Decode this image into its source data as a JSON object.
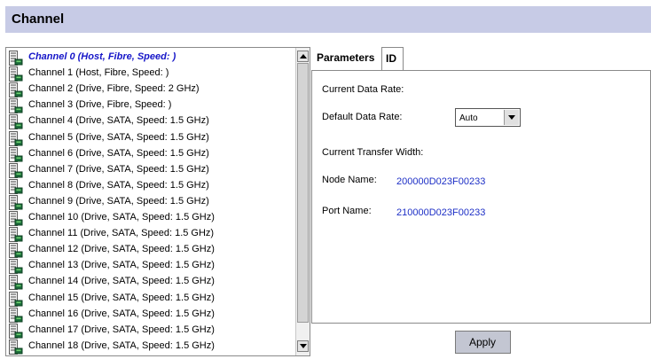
{
  "header": {
    "title": "Channel"
  },
  "channels": [
    "Channel 0 (Host, Fibre, Speed: )",
    "Channel 1 (Host, Fibre, Speed: )",
    "Channel 2 (Drive, Fibre, Speed: 2 GHz)",
    "Channel 3 (Drive, Fibre, Speed: )",
    "Channel 4 (Drive, SATA, Speed: 1.5 GHz)",
    "Channel 5 (Drive, SATA, Speed: 1.5 GHz)",
    "Channel 6 (Drive, SATA, Speed: 1.5 GHz)",
    "Channel 7 (Drive, SATA, Speed: 1.5 GHz)",
    "Channel 8 (Drive, SATA, Speed: 1.5 GHz)",
    "Channel 9 (Drive, SATA, Speed: 1.5 GHz)",
    "Channel 10 (Drive, SATA, Speed: 1.5 GHz)",
    "Channel 11 (Drive, SATA, Speed: 1.5 GHz)",
    "Channel 12 (Drive, SATA, Speed: 1.5 GHz)",
    "Channel 13 (Drive, SATA, Speed: 1.5 GHz)",
    "Channel 14 (Drive, SATA, Speed: 1.5 GHz)",
    "Channel 15 (Drive, SATA, Speed: 1.5 GHz)",
    "Channel 16 (Drive, SATA, Speed: 1.5 GHz)",
    "Channel 17 (Drive, SATA, Speed: 1.5 GHz)",
    "Channel 18 (Drive, SATA, Speed: 1.5 GHz)"
  ],
  "selected_channel_index": 0,
  "tabs": {
    "parameters": "Parameters",
    "id": "ID"
  },
  "params": {
    "current_data_rate_label": "Current Data Rate:",
    "default_data_rate_label": "Default Data Rate:",
    "default_data_rate_value": "Auto",
    "current_transfer_width_label": "Current Transfer Width:",
    "node_name_label": "Node Name:",
    "node_name_value": "200000D023F00233",
    "port_name_label": "Port Name:",
    "port_name_value": "210000D023F00233"
  },
  "apply_label": "Apply",
  "colors": {
    "header_bg": "#c7cbe6",
    "selected_text": "#1515c8",
    "value_text": "#1d2fc6",
    "apply_bg": "#c3c6d2"
  },
  "icons": {
    "channel_item": "server-channel-icon"
  }
}
